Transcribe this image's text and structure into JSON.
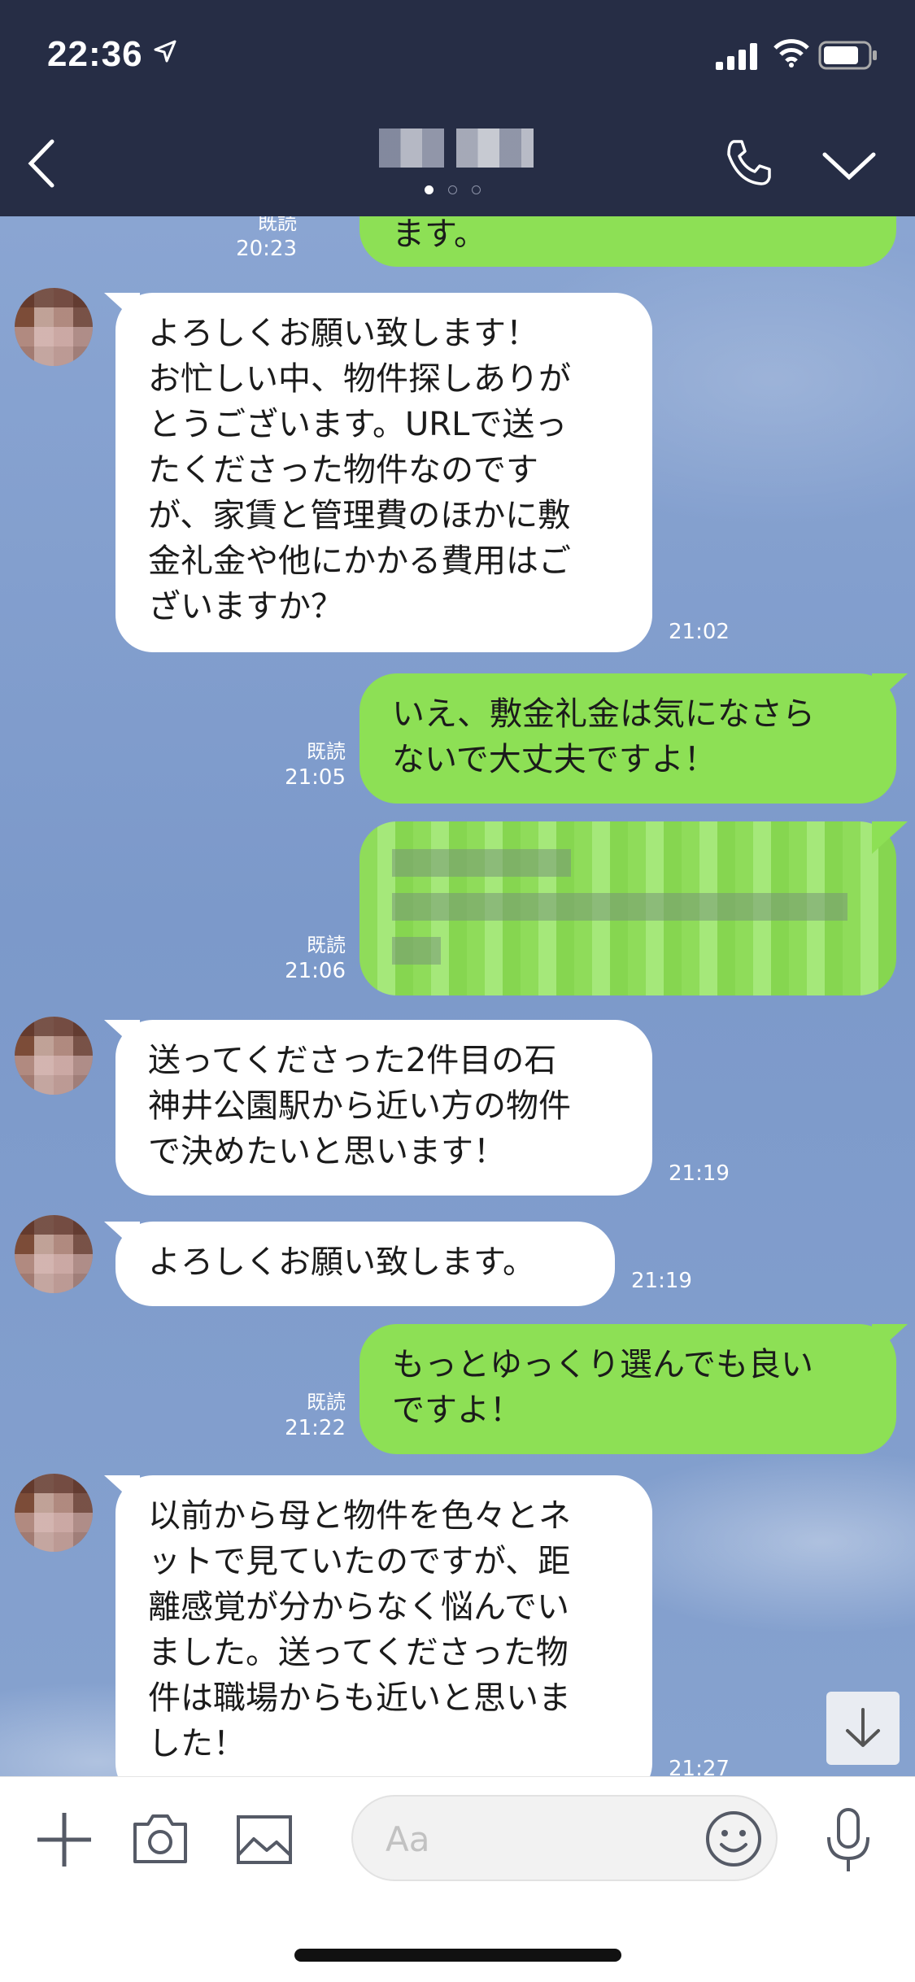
{
  "status": {
    "time": "22:36"
  },
  "header": {
    "title": ""
  },
  "messages": [
    {
      "dir": "out",
      "read": "既読",
      "time": "20:23",
      "text": "ます。"
    },
    {
      "dir": "in",
      "time": "21:02",
      "text": "よろしくお願い致します！\nお忙しい中、物件探しありが\nとうございます。URLで送っ\nたくださった物件なのです\nが、家賃と管理費のほかに敷\n金礼金や他にかかる費用はご\nざいますか？"
    },
    {
      "dir": "out",
      "read": "既読",
      "time": "21:05",
      "text": "いえ、敷金礼金は気になさら\nないで大丈夫ですよ！"
    },
    {
      "dir": "out",
      "read": "既読",
      "time": "21:06",
      "text": ""
    },
    {
      "dir": "in",
      "time": "21:19",
      "text": "送ってくださった2件目の石\n神井公園駅から近い方の物件\nで決めたいと思います！"
    },
    {
      "dir": "in",
      "time": "21:19",
      "text": "よろしくお願い致します。"
    },
    {
      "dir": "out",
      "read": "既読",
      "time": "21:22",
      "text": "もっとゆっくり選んでも良い\nですよ！"
    },
    {
      "dir": "in",
      "time": "21:27",
      "text": "以前から母と物件を色々とネ\nットで見ていたのですが、距\n離感覚が分からなく悩んでい\nました。送ってくださった物\n件は職場からも近いと思いま\nした！"
    }
  ],
  "input": {
    "placeholder": "Aa"
  },
  "icons": [
    "location-arrow-icon",
    "signal-icon",
    "wifi-icon",
    "battery-icon",
    "back-chevron-icon",
    "phone-icon",
    "chevron-down-icon",
    "scroll-down-arrow-icon",
    "plus-icon",
    "camera-icon",
    "image-icon",
    "emoji-icon",
    "microphone-icon"
  ],
  "colors": {
    "header_bg": "#262d45",
    "outgoing_bubble": "#8de055",
    "incoming_bubble": "#ffffff",
    "chat_bg": "#7f9ccc"
  }
}
